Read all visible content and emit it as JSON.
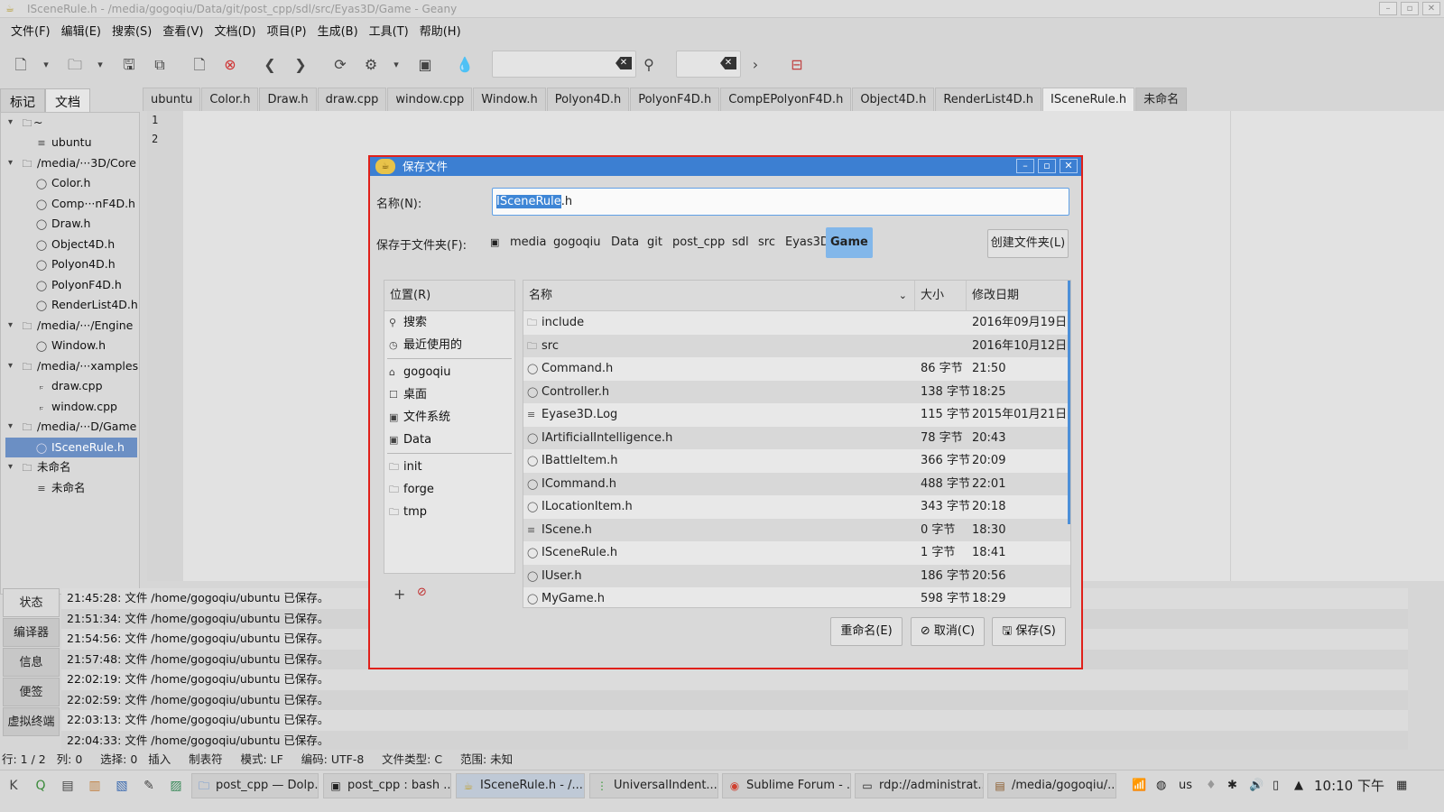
{
  "window": {
    "title": "ISceneRule.h - /media/gogoqiu/Data/git/post_cpp/sdl/src/Eyas3D/Game - Geany"
  },
  "menu": [
    "文件(F)",
    "编辑(E)",
    "搜索(S)",
    "查看(V)",
    "文档(D)",
    "项目(P)",
    "生成(B)",
    "工具(T)",
    "帮助(H)"
  ],
  "sidebar": {
    "tabs": [
      "标记",
      "文档"
    ],
    "tree": [
      {
        "label": "~",
        "type": "folder"
      },
      {
        "label": "ubuntu",
        "type": "doc"
      },
      {
        "label": "/media/···3D/Core",
        "type": "folder"
      },
      {
        "label": "Color.h",
        "type": "file"
      },
      {
        "label": "Comp···nF4D.h",
        "type": "file"
      },
      {
        "label": "Draw.h",
        "type": "file"
      },
      {
        "label": "Object4D.h",
        "type": "file"
      },
      {
        "label": "Polyon4D.h",
        "type": "file"
      },
      {
        "label": "PolyonF4D.h",
        "type": "file"
      },
      {
        "label": "RenderList4D.h",
        "type": "file"
      },
      {
        "label": "/media/···/Engine",
        "type": "folder"
      },
      {
        "label": "Window.h",
        "type": "file"
      },
      {
        "label": "/media/···xamples",
        "type": "folder"
      },
      {
        "label": "draw.cpp",
        "type": "cpp"
      },
      {
        "label": "window.cpp",
        "type": "cpp"
      },
      {
        "label": "/media/···D/Game",
        "type": "folder"
      },
      {
        "label": "ISceneRule.h",
        "type": "file"
      },
      {
        "label": "未命名",
        "type": "folder"
      },
      {
        "label": "未命名",
        "type": "doc"
      }
    ]
  },
  "editor_tabs": [
    "ubuntu",
    "Color.h",
    "Draw.h",
    "draw.cpp",
    "window.cpp",
    "Window.h",
    "Polyon4D.h",
    "PolyonF4D.h",
    "CompEPolyonF4D.h",
    "Object4D.h",
    "RenderList4D.h",
    "ISceneRule.h",
    "未命名"
  ],
  "editor": {
    "line_numbers": [
      "1",
      "2"
    ]
  },
  "bottom_tabs": [
    "状态",
    "编译器",
    "信息",
    "便签",
    "虚拟终端"
  ],
  "log": [
    "21:45:28: 文件 /home/gogoqiu/ubuntu 已保存。",
    "21:51:34: 文件 /home/gogoqiu/ubuntu 已保存。",
    "21:54:56: 文件 /home/gogoqiu/ubuntu 已保存。",
    "21:57:48: 文件 /home/gogoqiu/ubuntu 已保存。",
    "22:02:19: 文件 /home/gogoqiu/ubuntu 已保存。",
    "22:02:59: 文件 /home/gogoqiu/ubuntu 已保存。",
    "22:03:13: 文件 /home/gogoqiu/ubuntu 已保存。",
    "22:04:33: 文件 /home/gogoqiu/ubuntu 已保存。"
  ],
  "statusbar": "行: 1 / 2   列: 0     选择: 0   插入     制表符     模式: LF     编码: UTF-8     文件类型: C     范围: 未知",
  "dialog": {
    "title": "保存文件",
    "name_label": "名称(N):",
    "name_selected": "ISceneRule",
    "name_ext": ".h",
    "folder_label": "保存于文件夹(F):",
    "breadcrumbs": [
      "media",
      "gogoqiu",
      "Data",
      "git",
      "post_cpp",
      "sdl",
      "src",
      "Eyas3D",
      "Game"
    ],
    "create_folder": "创建文件夹(L)",
    "places_header": "位置(R)",
    "places": [
      "搜索",
      "最近使用的",
      "gogoqiu",
      "桌面",
      "文件系统",
      "Data",
      "init",
      "forge",
      "tmp"
    ],
    "columns": {
      "name": "名称",
      "size": "大小",
      "date": "修改日期"
    },
    "files": [
      {
        "name": "include",
        "size": "",
        "date": "2016年09月19日",
        "type": "folder"
      },
      {
        "name": "src",
        "size": "",
        "date": "2016年10月12日",
        "type": "folder"
      },
      {
        "name": "Command.h",
        "size": "86 字节",
        "date": "21:50",
        "type": "file"
      },
      {
        "name": "Controller.h",
        "size": "138 字节",
        "date": "18:25",
        "type": "file"
      },
      {
        "name": "Eyase3D.Log",
        "size": "115 字节",
        "date": "2015年01月21日",
        "type": "doc"
      },
      {
        "name": "IArtificialIntelligence.h",
        "size": "78 字节",
        "date": "20:43",
        "type": "file"
      },
      {
        "name": "IBattleItem.h",
        "size": "366 字节",
        "date": "20:09",
        "type": "file"
      },
      {
        "name": "ICommand.h",
        "size": "488 字节",
        "date": "22:01",
        "type": "file"
      },
      {
        "name": "ILocationItem.h",
        "size": "343 字节",
        "date": "20:18",
        "type": "file"
      },
      {
        "name": "IScene.h",
        "size": "0 字节",
        "date": "18:30",
        "type": "doc"
      },
      {
        "name": "ISceneRule.h",
        "size": "1 字节",
        "date": "18:41",
        "type": "file"
      },
      {
        "name": "IUser.h",
        "size": "186 字节",
        "date": "20:56",
        "type": "file"
      },
      {
        "name": "MyGame.h",
        "size": "598 字节",
        "date": "18:29",
        "type": "file"
      }
    ],
    "rename_button": "重命名(E)",
    "cancel_button": "取消(C)",
    "save_button": "保存(S)"
  },
  "taskbar": {
    "tasks": [
      "post_cpp — Dolp...",
      "post_cpp : bash ...",
      "ISceneRule.h - /...",
      "UniversalIndent...",
      "Sublime Forum - ...",
      "rdp://administrat...",
      "/media/gogoqiu/..."
    ],
    "tray_lang": "us",
    "clock": "10:10 下午"
  },
  "colors": {
    "selection": "#6b8fc4",
    "dialog_title": "#3c7fd2",
    "dialog_border": "#e0201a",
    "breadcrumb_active": "#82b7ea"
  }
}
